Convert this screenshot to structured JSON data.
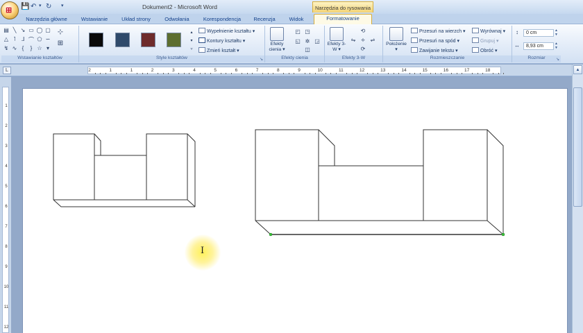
{
  "window": {
    "title": "Dokument2 - Microsoft Word",
    "context_tab_title": "Narzędzia do rysowania"
  },
  "tabs": [
    {
      "label": "Narzędzia główne"
    },
    {
      "label": "Wstawianie"
    },
    {
      "label": "Układ strony"
    },
    {
      "label": "Odwołania"
    },
    {
      "label": "Korespondencja"
    },
    {
      "label": "Recenzja"
    },
    {
      "label": "Widok"
    },
    {
      "label": "Formatowanie",
      "active": true
    }
  ],
  "ribbon": {
    "insert_shapes": {
      "label": "Wstawianie kształtów"
    },
    "shape_styles": {
      "label": "Style kształtów",
      "swatch_colors": [
        "#0a0a0a",
        "#2f4a6b",
        "#6e2b2b",
        "#5d6e2f"
      ],
      "fill": "Wypełnienie kształtu",
      "outline": "Kontury kształtu",
      "change": "Zmień kształt"
    },
    "shadow_effects": {
      "label": "Efekty cienia",
      "button": "Efekty cienia"
    },
    "effects_3d": {
      "label": "Efekty 3-W",
      "button": "Efekty 3-W"
    },
    "arrange": {
      "label": "Rozmieszczanie",
      "position": "Położenie",
      "bring_front": "Przesuń na wierzch",
      "send_back": "Przesuń na spód",
      "wrap_text": "Zawijanie tekstu",
      "align": "Wyrównaj",
      "group": "Grupuj",
      "rotate": "Obróć"
    },
    "size": {
      "label": "Rozmiar",
      "height": "0 cm",
      "width": "8,93 cm"
    }
  },
  "ruler": {
    "numbers": [
      "2",
      "1",
      "1",
      "2",
      "3",
      "4",
      "5",
      "6",
      "7",
      "8",
      "9",
      "10",
      "11",
      "12",
      "13",
      "14",
      "15",
      "16",
      "17",
      "18"
    ],
    "vertical_numbers": [
      "1",
      "2",
      "3",
      "4",
      "5",
      "6",
      "7",
      "8",
      "9",
      "10",
      "11",
      "12"
    ]
  },
  "icons": {
    "office_button": "office-logo-icon",
    "save": "save-icon",
    "undo": "undo-icon",
    "redo": "redo-icon",
    "cursor": "ibeam-cursor-icon"
  }
}
